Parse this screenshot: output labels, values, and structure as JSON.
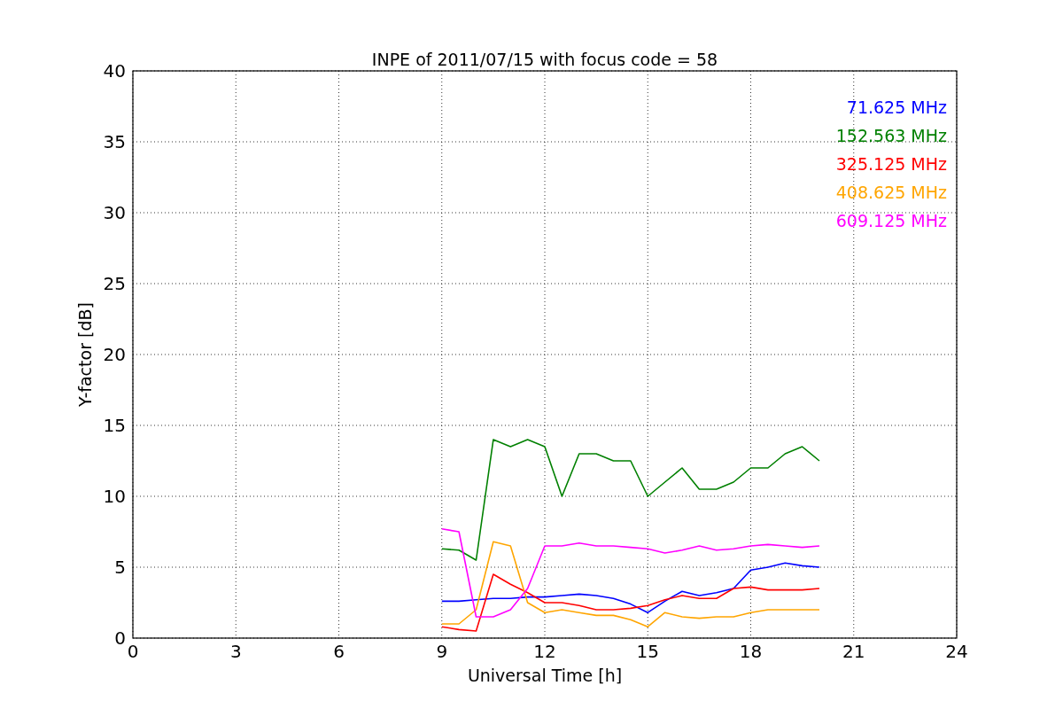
{
  "figure": {
    "chart_data": {
      "type": "line",
      "title": "INPE of 2011/07/15 with focus code = 58",
      "xlabel": "Universal Time [h]",
      "ylabel": "Y-factor [dB]",
      "x": [
        9,
        9.5,
        10,
        10.5,
        11,
        11.5,
        12,
        12.5,
        13,
        13.5,
        14,
        14.5,
        15,
        15.5,
        16,
        16.5,
        17,
        17.5,
        18,
        18.5,
        19,
        19.5,
        20
      ],
      "series": [
        {
          "name": "71.625 MHz",
          "color": "#0000ff",
          "values": [
            2.6,
            2.6,
            2.7,
            2.8,
            2.8,
            2.9,
            2.9,
            3.0,
            3.1,
            3.0,
            2.8,
            2.4,
            1.8,
            2.6,
            3.3,
            3.0,
            3.2,
            3.5,
            4.8,
            5.0,
            5.3,
            5.1,
            5.0
          ]
        },
        {
          "name": "152.563 MHz",
          "color": "#008000",
          "values": [
            6.3,
            6.2,
            5.5,
            14,
            13.5,
            14,
            13.5,
            10,
            13,
            13,
            12.5,
            12.5,
            10,
            11,
            12,
            10.5,
            10.5,
            11,
            12,
            12,
            13,
            13.5,
            12.5
          ]
        },
        {
          "name": "325.125 MHz",
          "color": "#ff0000",
          "values": [
            0.8,
            0.6,
            0.5,
            4.5,
            3.8,
            3.2,
            2.5,
            2.5,
            2.3,
            2.0,
            2.0,
            2.1,
            2.3,
            2.7,
            3.0,
            2.8,
            2.8,
            3.5,
            3.6,
            3.4,
            3.4,
            3.4,
            3.5
          ]
        },
        {
          "name": "408.625 MHz",
          "color": "#ffa500",
          "values": [
            1.0,
            1.0,
            2.0,
            6.8,
            6.5,
            2.5,
            1.8,
            2.0,
            1.8,
            1.6,
            1.6,
            1.3,
            0.8,
            1.8,
            1.5,
            1.4,
            1.5,
            1.5,
            1.8,
            2.0,
            2.0,
            2.0,
            2.0
          ]
        },
        {
          "name": "609.125 MHz",
          "color": "#ff00ff",
          "values": [
            7.7,
            7.5,
            1.5,
            1.5,
            2.0,
            3.5,
            6.5,
            6.5,
            6.7,
            6.5,
            6.5,
            6.4,
            6.3,
            6.0,
            6.2,
            6.5,
            6.2,
            6.3,
            6.5,
            6.6,
            6.5,
            6.4,
            6.5
          ]
        }
      ],
      "xlim": [
        0,
        24
      ],
      "ylim": [
        0,
        40
      ],
      "xticks": [
        0,
        3,
        6,
        9,
        12,
        15,
        18,
        21,
        24
      ],
      "yticks": [
        0,
        5,
        10,
        15,
        20,
        25,
        30,
        35,
        40
      ],
      "grid": true
    }
  }
}
